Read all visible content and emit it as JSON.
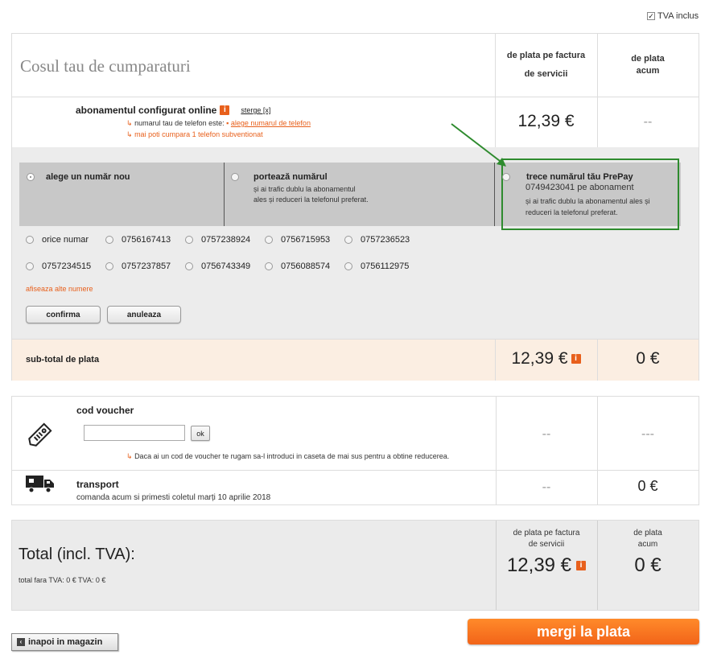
{
  "tva": {
    "label": "TVA inclus",
    "checked": true
  },
  "cart": {
    "title": "Cosul tau de cumparaturi",
    "col_invoice_line1": "de plata pe factura",
    "col_invoice_line2": "de servicii",
    "col_now_line1": "de plata",
    "col_now_line2": "acum"
  },
  "subscription": {
    "name": "abonamentul configurat online",
    "delete_label": "sterge [x]",
    "phone_note": "numarul tau de telefon este:",
    "choose_number_link": "alege numarul de telefon",
    "subsidized_note": "mai poti cumpara 1 telefon subventionat",
    "price_invoice": "12,39 €",
    "price_now": "--"
  },
  "number_options": {
    "new": {
      "title": "alege un număr nou",
      "selected": true
    },
    "port": {
      "title": "portează numărul",
      "desc1": "și ai trafic dublu la abonamentul",
      "desc2": "ales și reduceri la telefonul preferat."
    },
    "prepay": {
      "title": "trece numărul tău PrePay",
      "subtitle": "0749423041 pe abonament",
      "desc1": "și ai trafic dublu la abonamentul ales și",
      "desc2": "reduceri la telefonul preferat."
    }
  },
  "numbers": [
    "orice numar",
    "0756167413",
    "0757238924",
    "0756715953",
    "0757236523",
    "0757234515",
    "0757237857",
    "0756743349",
    "0756088574",
    "0756112975"
  ],
  "show_more_label": "afiseaza alte numere",
  "confirm_label": "confirma",
  "cancel_label": "anuleaza",
  "subtotal": {
    "label": "sub-total de plata",
    "invoice": "12,39 €",
    "now": "0 €"
  },
  "voucher": {
    "title": "cod voucher",
    "input_value": "",
    "ok_label": "ok",
    "hint": "Daca ai un cod de voucher te rugam sa-l introduci in caseta de mai sus pentru a obtine reducerea.",
    "invoice": "--",
    "now": "---"
  },
  "transport": {
    "title": "transport",
    "note": "comanda acum si primesti coletul marți 10 aprilie 2018",
    "invoice": "--",
    "now": "0 €"
  },
  "total": {
    "title": "Total (incl. TVA):",
    "subnote": "total fara TVA: 0 € TVA: 0 €",
    "col_invoice_line1": "de plata pe factura",
    "col_invoice_line2": "de servicii",
    "col_now_line1": "de plata",
    "col_now_line2": "acum",
    "invoice": "12,39 €",
    "now": "0 €"
  },
  "checkout_label": "mergi la plata",
  "back_label": "inapoi in magazin",
  "colors": {
    "accent": "#e8601c",
    "highlight_green": "#2e8b2e",
    "option_gray": "#c8c8c8",
    "subtotal_bg": "#fbeee2"
  }
}
